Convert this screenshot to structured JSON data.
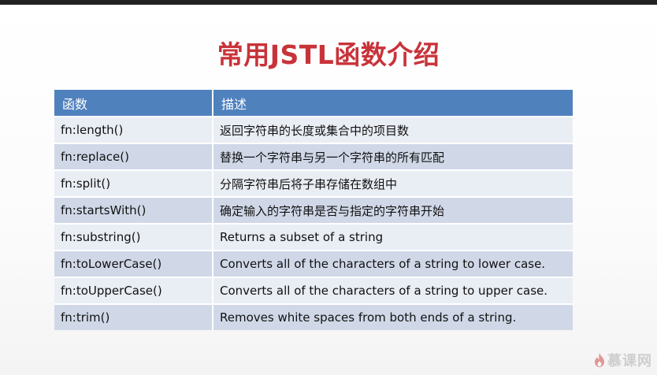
{
  "title": "常用JSTL函数介绍",
  "table": {
    "headers": [
      "函数",
      "描述"
    ],
    "rows": [
      {
        "fn": "fn:length()",
        "desc": "返回字符串的长度或集合中的项目数"
      },
      {
        "fn": "fn:replace()",
        "desc": "替换一个字符串与另一个字符串的所有匹配"
      },
      {
        "fn": "fn:split()",
        "desc": "分隔字符串后将子串存储在数组中"
      },
      {
        "fn": "fn:startsWith()",
        "desc": "确定输入的字符串是否与指定的字符串开始"
      },
      {
        "fn": "fn:substring()",
        "desc": "Returns a subset of a string"
      },
      {
        "fn": "fn:toLowerCase()",
        "desc": "Converts all of the characters of a string to lower case."
      },
      {
        "fn": "fn:toUpperCase()",
        "desc": "Converts all of the characters of a string to upper case."
      },
      {
        "fn": "fn:trim()",
        "desc": "Removes white spaces from both ends of a string."
      }
    ]
  },
  "watermark": {
    "text": "慕课网",
    "icon": "flame-icon"
  },
  "colors": {
    "title": "#c8333a",
    "header_bg": "#4f81bd",
    "row_light": "#e9edf4",
    "row_dark": "#d0d8e8"
  }
}
